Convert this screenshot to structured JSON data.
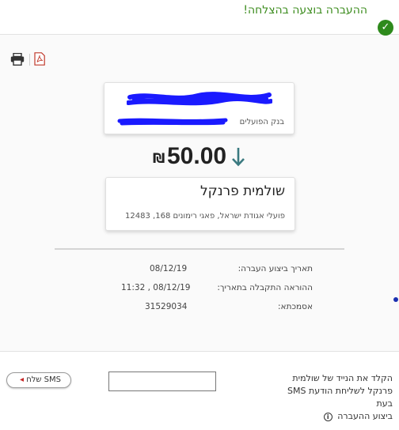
{
  "banner": {
    "success_text": "ההעברה בוצעה בהצלחה!",
    "success_icon": "check-icon"
  },
  "toolbar": {
    "print_icon": "print-icon",
    "pdf_icon": "pdf-icon"
  },
  "account": {
    "bank_name": "בנק הפועלים"
  },
  "amount": {
    "currency": "₪",
    "value": "50.00",
    "direction_icon": "arrow-down-icon"
  },
  "payee": {
    "name": "שולמית פרנקל",
    "address": "פועלי אגודת ישראל, פאגי רימונים 168, 12483"
  },
  "details": {
    "date_label": "תאריך ביצוע העברה:",
    "date_value": "08/12/19",
    "received_label": "ההוראה התקבלה בתאריך:",
    "received_value": "08/12/19 , 11:32",
    "ref_label": "אסמכתא:",
    "ref_value": "31529034"
  },
  "sms": {
    "line1": "הקלד את הנייד של שולמית",
    "line2": "פרנקל לשליחת הודעת SMS בעת",
    "line3": "ביצוע ההעברה",
    "info_icon": "info-icon",
    "phone_value": "",
    "send_label": "שלח SMS"
  },
  "colors": {
    "success_green": "#3c8c1e",
    "mask_blue": "#1a1aff",
    "arrow_teal": "#3b7a80",
    "send_arrow_red": "#c62828"
  }
}
